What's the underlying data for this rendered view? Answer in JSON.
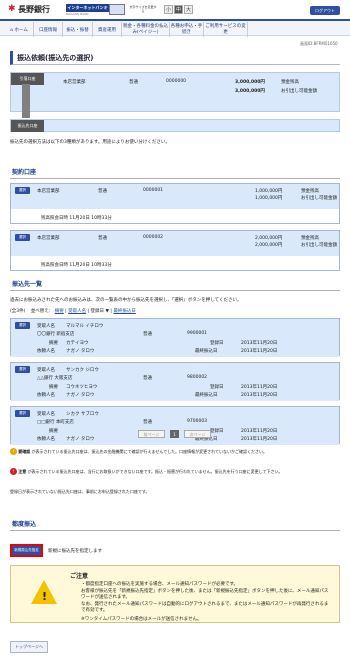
{
  "header": {
    "bank_name": "長野銀行",
    "banner": "インターネットバンキング",
    "banner_sub": "NAGANO BANK",
    "font_label": "文字サイズを変更する",
    "font_sizes": [
      "小",
      "中",
      "大"
    ],
    "logout": "ログアウト"
  },
  "nav": [
    "ホーム",
    "口座情報",
    "振込・振替",
    "資産運用",
    "税金・各種料金の払込み(ペイジー)",
    "各種お申込・手続き",
    "ご利用サービスの変更"
  ],
  "screen_id": "画面ID:BFRM01650",
  "page_title": "振込依頼(振込先の選択)",
  "from": {
    "label": "引落口座",
    "branch": "本店営業部",
    "type": "普通",
    "number": "0000000",
    "amount1": "3,000,000円",
    "amount2": "3,000,000円",
    "caption1": "預金残高",
    "caption2": "お引出し可能金額"
  },
  "to_label": "振込先口座",
  "intro": "振込先の選択方法は以下の3種類があります。用途によりお使い分けください。",
  "contract": {
    "title": "契約口座",
    "accounts": [
      {
        "button": "選択",
        "branch": "本店営業部",
        "type": "普通",
        "number": "0000001",
        "amount1": "1,000,000円",
        "amount2": "1,000,000円",
        "caption1": "預金残高",
        "caption2": "お引出し可能金額",
        "date": "残高照会日時 11月20日 10時33分"
      },
      {
        "button": "選択",
        "branch": "本店営業部",
        "type": "普通",
        "number": "0000002",
        "amount1": "2,000,000円",
        "amount2": "2,000,000円",
        "caption1": "預金残高",
        "caption2": "お引出し可能金額",
        "date": "残高照会日時 11月20日 10時33分"
      }
    ]
  },
  "payees": {
    "title": "振込先一覧",
    "intro": "過去にお振込みされた先へのお振込みは、次の一覧表の中から振込先を選択し、「選択」ボタンを押してください。",
    "total": "(全3件)",
    "sort_label": "並べ替え：",
    "sort_links": [
      "摘要",
      "受取人名",
      "登録日 ▼",
      "最終振込日"
    ],
    "items": [
      {
        "button": "選択",
        "recipient_label": "受取人名",
        "recipient": "マルマル イチロウ",
        "bank": "〇〇銀行 新宿支店",
        "type": "普通",
        "number": "9900001",
        "memo_label": "摘要",
        "memo": "カテイヨウ",
        "requester_label": "依頼人名",
        "requester": "ナガノ タロウ",
        "registered_label": "登録日",
        "registered": "2013年11月20日",
        "last_label": "最終振込日",
        "last": "2013年11月20日"
      },
      {
        "button": "選択",
        "recipient_label": "受取人名",
        "recipient": "サンカク ジロウ",
        "bank": "△△銀行 大阪支店",
        "type": "普通",
        "number": "9800002",
        "memo_label": "摘要",
        "memo": "コウネツヒヨウ",
        "requester_label": "依頼人名",
        "requester": "ナガノ タロウ",
        "registered_label": "登録日",
        "registered": "2013年11月20日",
        "last_label": "最終振込日",
        "last": "2013年11月20日"
      },
      {
        "button": "選択",
        "recipient_label": "受取人名",
        "recipient": "シカク サブロウ",
        "bank": "□□銀行 本町支店",
        "type": "普通",
        "number": "9700003",
        "memo_label": "摘要",
        "memo": "",
        "requester_label": "依頼人名",
        "requester": "ナガノ タロウ",
        "registered_label": "登録日",
        "registered": "2013年11月20日",
        "last_label": "最終振込日",
        "last": "2013年11月20日"
      }
    ]
  },
  "pager": {
    "prev": "前ページ",
    "page": "1",
    "next": "次ページ"
  },
  "notices": [
    {
      "label": "要確認",
      "text": "が表示されている振込先口座は、振込先の金融機関にて確認が行えませんでした。口座情報が変更されていないかご確認ください。"
    },
    {
      "label": "注意",
      "text": "が表示されている振込先口座は、当行にお取扱いができない口座です。振込・振替が行われていません。振込先を行う口座に変更して下さい。"
    }
  ],
  "notice_footer": "登録日が表示されていない振込先口座は、事前にお申込登録された口座です。",
  "new": {
    "title": "都度振込",
    "button": "新規振込先指定",
    "text": "新規に振込先を指定します"
  },
  "attention": {
    "title": "ご注意",
    "lines": [
      "・都度指定口座への振込を実施する場合、メール通知パスワードが必要です。",
      "お客様が振込先を「新規振込先指定」ボタンを押した後、または「新規振込先指定」ボタンを押した後に、メール通知パスワードが送信されます。",
      "なお、発行されたメール通知パスワードは自動的にログアウトされるまで、またはメール通知パスワードが再発行されるまで有効です。",
      "※ワンタイムパスワードの場合はメールが送信されません。"
    ]
  },
  "top_button": "トップページへ"
}
